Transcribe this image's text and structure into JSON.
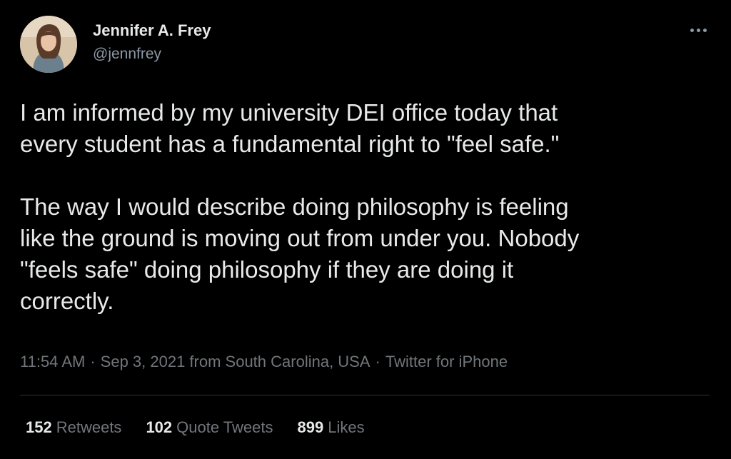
{
  "author": {
    "name": "Jennifer A. Frey",
    "handle": "@jennfrey",
    "avatar_icon": "profile-photo"
  },
  "more_icon": "more-horizontal-icon",
  "tweet": {
    "paragraph_1": [
      "I am informed by my university DEI office today that",
      "every student has a fundamental right to \"feel safe.\""
    ],
    "paragraph_2": [
      "The way I would describe doing philosophy is feeling",
      "like the ground is moving out from under you. Nobody",
      "\"feels safe\" doing philosophy if they are doing it",
      "correctly."
    ]
  },
  "meta": {
    "time": "11:54 AM",
    "date_location": "Sep 3, 2021 from South Carolina, USA",
    "source": "Twitter for iPhone",
    "separator": "·"
  },
  "stats": {
    "retweets_count": "152",
    "retweets_label": "Retweets",
    "quotes_count": "102",
    "quotes_label": "Quote Tweets",
    "likes_count": "899",
    "likes_label": "Likes"
  },
  "colors": {
    "background": "#000000",
    "primary_text": "#e7e9ea",
    "secondary_text": "#71767b",
    "divider": "#2f3336"
  }
}
